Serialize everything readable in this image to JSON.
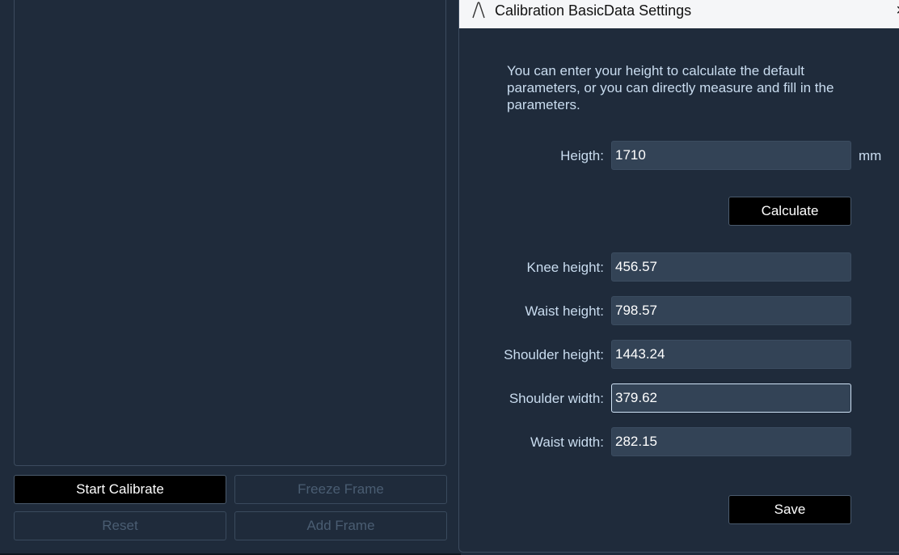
{
  "left_panel": {
    "buttons": {
      "start_calibrate": "Start Calibrate",
      "freeze_frame": "Freeze Frame",
      "reset": "Reset",
      "add_frame": "Add Frame"
    }
  },
  "dialog": {
    "title": "Calibration BasicData Settings",
    "close_glyph": "×",
    "intro": "You can enter your height to calculate the default parameters, or you can directly measure and fill in the parameters.",
    "height": {
      "label": "Heigth:",
      "value": "1710",
      "unit": "mm"
    },
    "calculate_label": "Calculate",
    "fields": {
      "knee_height": {
        "label": "Knee height:",
        "value": "456.57"
      },
      "waist_height": {
        "label": "Waist height:",
        "value": "798.57"
      },
      "shoulder_height": {
        "label": "Shoulder height:",
        "value": "1443.24"
      },
      "shoulder_width": {
        "label": "Shoulder width:",
        "value": "379.62"
      },
      "waist_width": {
        "label": "Waist width:",
        "value": "282.15"
      }
    },
    "save_label": "Save"
  },
  "icons": {
    "app": "app-logo-icon",
    "close": "close-icon"
  },
  "colors": {
    "background": "#1f2b3b",
    "field_background": "#334356",
    "label_text": "#c9dcef",
    "primary_button": "#000000",
    "disabled_text": "#4a5d72"
  }
}
